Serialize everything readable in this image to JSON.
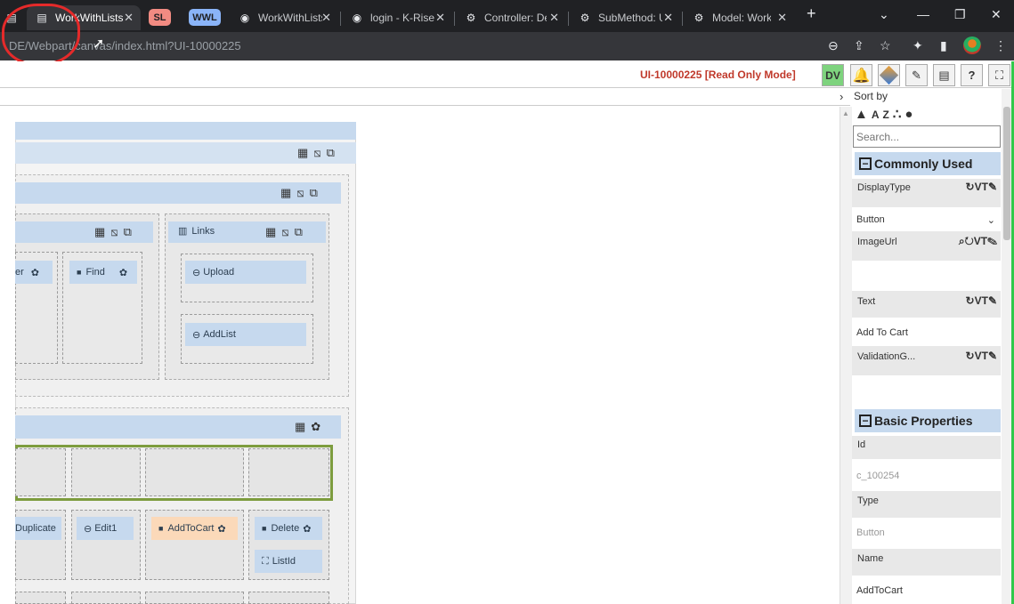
{
  "browser": {
    "tabs": [
      {
        "title": "WorkWithLists",
        "icon": "document-icon",
        "active": true
      },
      {
        "title": "WorkWithLists",
        "icon": "globe-icon"
      },
      {
        "title": "login - K-Rise",
        "icon": "globe-icon"
      },
      {
        "title": "Controller: De",
        "icon": "cogs-icon"
      },
      {
        "title": "SubMethod: U",
        "icon": "cogs-icon"
      },
      {
        "title": "Model: Work",
        "icon": "cogs-icon"
      }
    ],
    "tab_groups": [
      {
        "label": "SL",
        "color": "#f28b82"
      },
      {
        "label": "WWL",
        "color": "#8ab4f8"
      }
    ],
    "new_tab": "+",
    "url": "DE/Webpart/canvas/index.html?UI-10000225"
  },
  "toolbar": {
    "mode_text": "UI-10000225 [Read Only Mode]",
    "dv_label": "DV"
  },
  "canvas": {
    "buttons": {
      "register": "er",
      "find": "Find",
      "upload": "Upload",
      "addlist": "AddList",
      "duplicate": "Duplicate",
      "edit1": "Edit1",
      "addtocart": "AddToCart",
      "delete": "Delete",
      "listid": "ListId"
    },
    "links_title": "Links"
  },
  "properties": {
    "sort_by": "Sort by",
    "search_placeholder": "Search...",
    "commonly_used": "Commonly Used",
    "basic_properties": "Basic Properties",
    "display_type_label": "DisplayType",
    "display_type_value": "Button",
    "image_url_label": "ImageUrl",
    "text_label": "Text",
    "text_value": "Add To Cart",
    "validation_label": "ValidationG...",
    "id_label": "Id",
    "id_value": "c_100254",
    "type_label": "Type",
    "type_value": "Button",
    "name_label": "Name",
    "name_value": "AddToCart",
    "vt": "VT"
  },
  "colors": {
    "accent_bar": "#c6d9ee",
    "annotation": "#e52a2a",
    "mode_text": "#c0392b",
    "dv_button": "#7ed37e"
  }
}
